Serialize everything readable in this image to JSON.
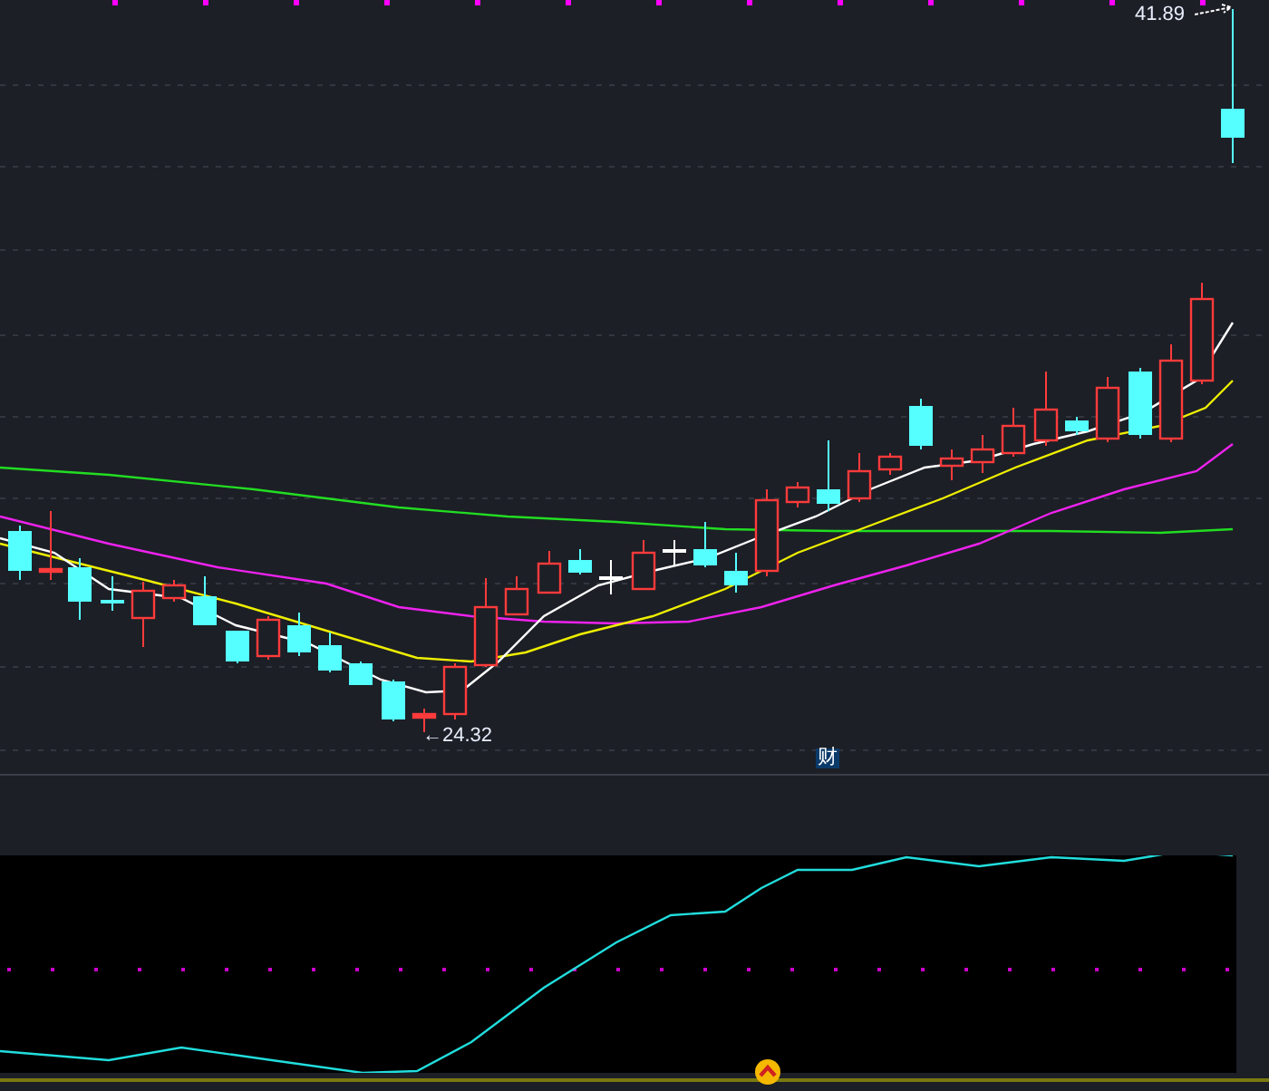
{
  "price_chart": {
    "high_label": "41.89",
    "low_label": "←24.32",
    "event_marker": "财"
  }
}
